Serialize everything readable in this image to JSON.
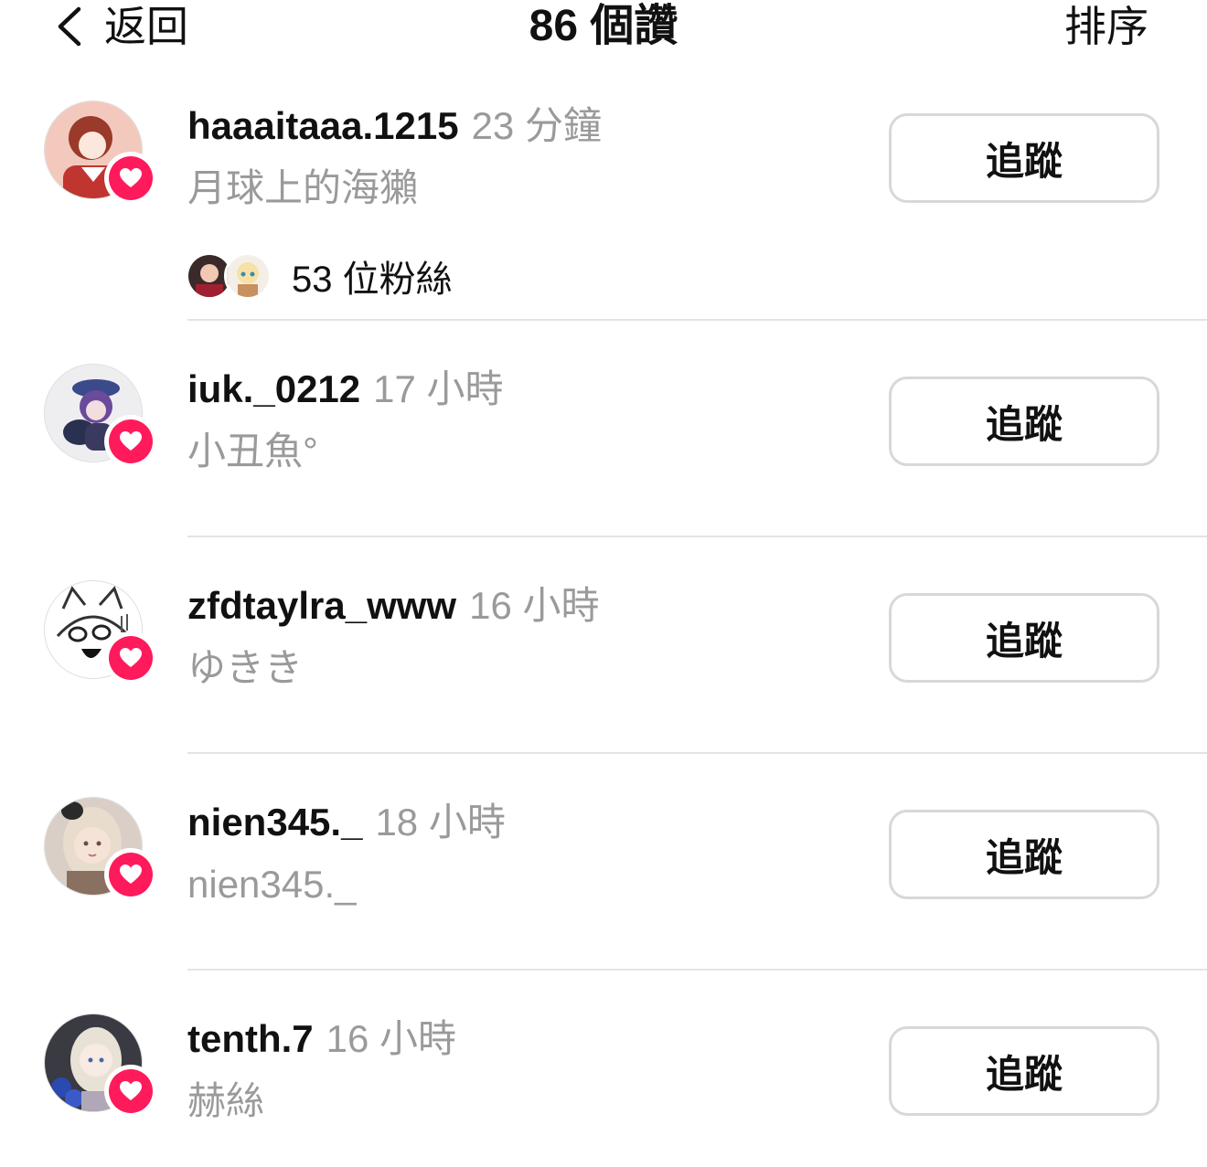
{
  "header": {
    "back_label": "返回",
    "title": "86 個讚",
    "sort_label": "排序"
  },
  "colors": {
    "heart_badge": "#ff1a5c",
    "secondary_text": "#9a9a9a",
    "divider": "#e4e4e4"
  },
  "likes": [
    {
      "username": "haaaitaaa.1215",
      "time": "23 分鐘",
      "full_name": "月球上的海獺",
      "follow_label": "追蹤",
      "mutual_followers": "53 位粉絲"
    },
    {
      "username": "iuk._0212",
      "time": "17 小時",
      "full_name": "小丑魚°",
      "follow_label": "追蹤"
    },
    {
      "username": "zfdtaylra_www",
      "time": "16 小時",
      "full_name": "ゆきき",
      "follow_label": "追蹤"
    },
    {
      "username": "nien345._",
      "time": "18 小時",
      "full_name": "nien345._",
      "follow_label": "追蹤"
    },
    {
      "username": "tenth.7",
      "time": "16 小時",
      "full_name": "赫絲",
      "follow_label": "追蹤"
    }
  ]
}
